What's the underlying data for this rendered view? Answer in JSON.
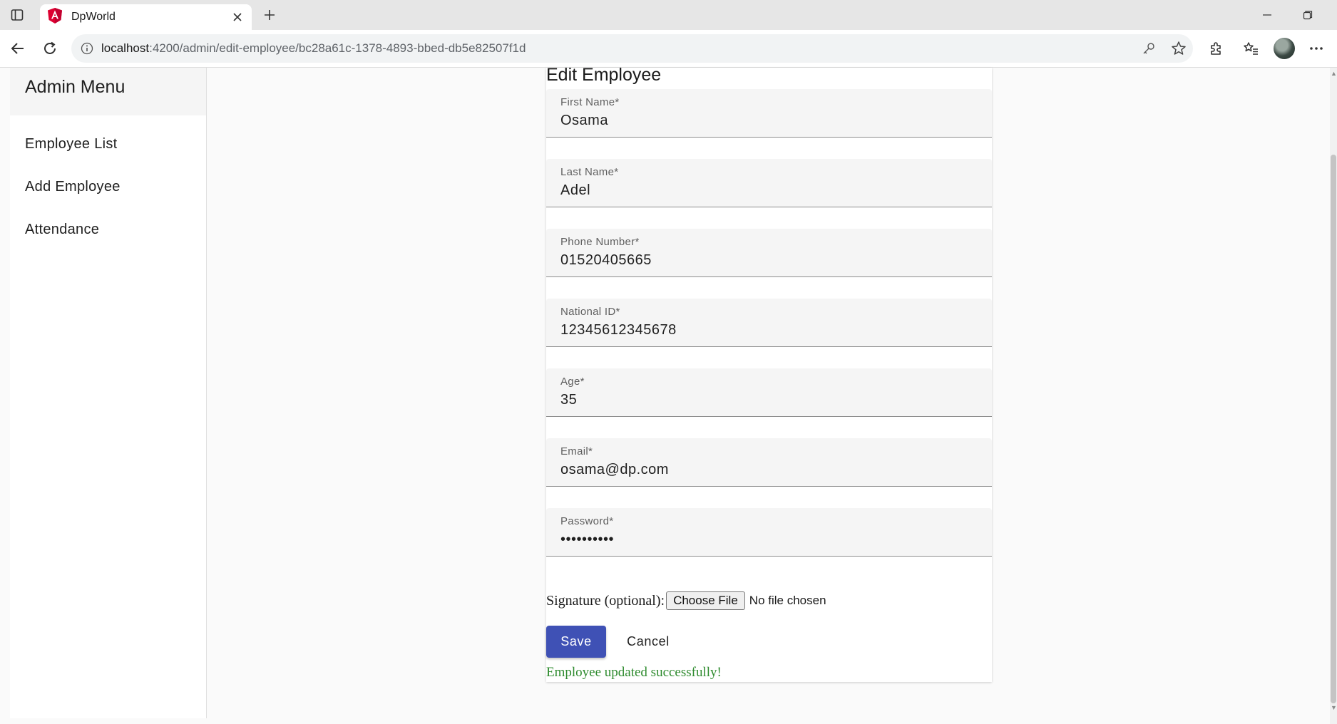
{
  "browser": {
    "tab_title": "DpWorld",
    "url_host": "localhost",
    "url_path": ":4200/admin/edit-employee/bc28a61c-1378-4893-bbed-db5e82507f1d"
  },
  "sidebar": {
    "title": "Admin Menu",
    "items": [
      {
        "label": "Employee List"
      },
      {
        "label": "Add Employee"
      },
      {
        "label": "Attendance"
      }
    ]
  },
  "form": {
    "title": "Edit Employee",
    "fields": [
      {
        "label": "First Name*",
        "value": "Osama",
        "type": "text"
      },
      {
        "label": "Last Name*",
        "value": "Adel",
        "type": "text"
      },
      {
        "label": "Phone Number*",
        "value": "01520405665",
        "type": "text"
      },
      {
        "label": "National ID*",
        "value": "12345612345678",
        "type": "text"
      },
      {
        "label": "Age*",
        "value": "35",
        "type": "text"
      },
      {
        "label": "Email*",
        "value": "osama@dp.com",
        "type": "text"
      },
      {
        "label": "Password*",
        "value": "1234567890",
        "type": "password"
      }
    ],
    "signature_label": "Signature (optional):",
    "choose_file_label": "Choose File",
    "file_status": "No file chosen",
    "save_label": "Save",
    "cancel_label": "Cancel",
    "success_message": "Employee updated successfully!"
  },
  "colors": {
    "primary": "#3f51b5",
    "success": "#2e8b2e",
    "angular_logo": "#dd0031"
  }
}
